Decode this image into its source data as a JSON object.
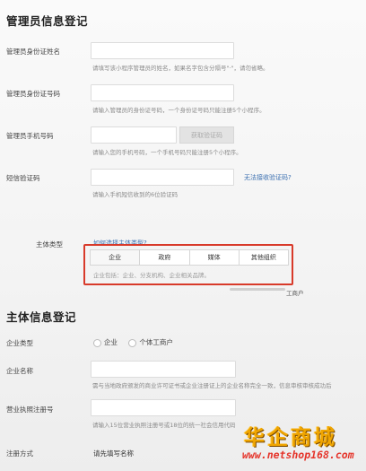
{
  "admin_section": {
    "title": "管理员信息登记",
    "id_name": {
      "label": "管理员身份证姓名",
      "hint": "请填写该小程序管理员的姓名，如果名字包含分隔号\"·\"，请勿省略。"
    },
    "id_number": {
      "label": "管理员身份证号码",
      "hint": "请输入管理员的身份证号码，一个身份证号码只能注册5个小程序。"
    },
    "phone": {
      "label": "管理员手机号码",
      "button": "获取验证码",
      "hint": "请输入您的手机号码，一个手机号码只能注册5个小程序。"
    },
    "sms": {
      "label": "短信验证码",
      "link": "无法接收验证码?",
      "hint": "请输入手机短信收到的6位验证码"
    }
  },
  "entity_type": {
    "label": "主体类型",
    "help_link": "如何选择主体类型?",
    "options": [
      "企业",
      "政府",
      "媒体",
      "其他组织"
    ],
    "description": "企业包括：企业、分支机构、企业相关品牌。",
    "overflow_text": "工商户"
  },
  "entity_section": {
    "title": "主体信息登记",
    "company_type": {
      "label": "企业类型",
      "options": [
        "企业",
        "个体工商户"
      ]
    },
    "company_name": {
      "label": "企业名称",
      "hint": "需与当地政府颁发的商业许可证书或企业注册证上的企业名称完全一致，信息审核审核成功后"
    },
    "license_no": {
      "label": "营业执照注册号",
      "hint": "请输入15位营业执照注册号或18位的统一社会信用代码"
    },
    "reg_method": {
      "label": "注册方式",
      "value": "请先填写名称"
    }
  },
  "watermark": {
    "brand": "华企商城",
    "url": "www.netshop168.com"
  },
  "colors": {
    "highlight": "#d83a2a",
    "link": "#3a6fb0",
    "watermark_gold": "#f0a500",
    "watermark_red": "#e53329"
  }
}
